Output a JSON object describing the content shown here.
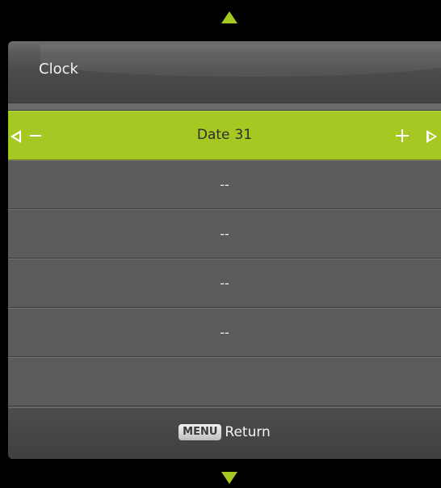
{
  "menu": {
    "title": "Clock"
  },
  "selected_item": {
    "label": "Date",
    "value": "31"
  },
  "items": [
    {
      "label": "--"
    },
    {
      "label": "--"
    },
    {
      "label": "--"
    },
    {
      "label": "--"
    },
    {
      "label": ""
    }
  ],
  "footer": {
    "key_label": "MENU",
    "action_label": "Return"
  },
  "icons": {
    "scroll_up": "triangle-up-icon",
    "scroll_down": "triangle-down-icon",
    "decrease": "minus-icon",
    "increase": "plus-icon",
    "prev": "arrow-left-icon",
    "next": "arrow-right-icon"
  },
  "colors": {
    "accent": "#a5c823",
    "panel": "#5b5b5b",
    "header": "#4a4a4a",
    "background": "#000000"
  }
}
